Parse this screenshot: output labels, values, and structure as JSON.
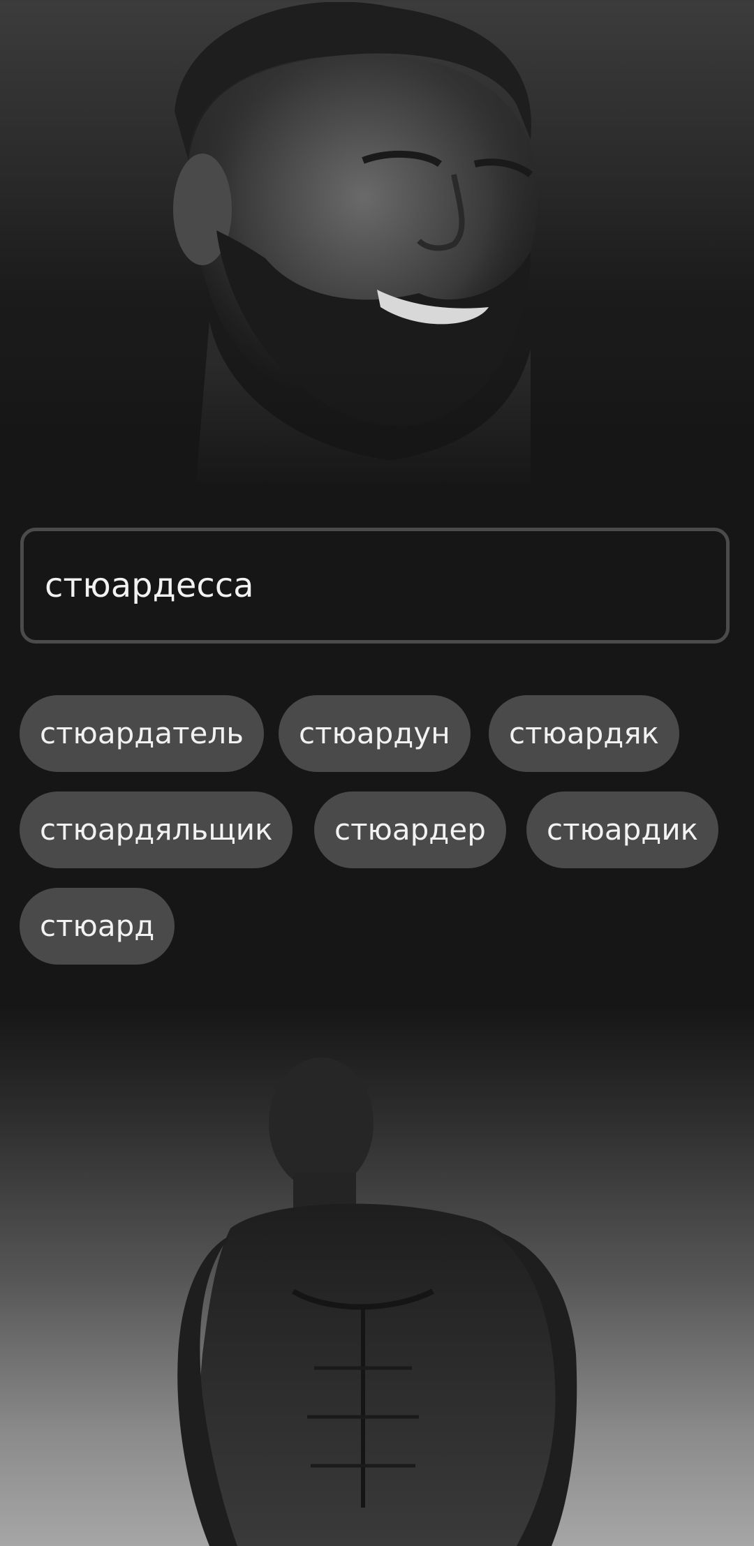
{
  "search": {
    "value": "стюардесса",
    "placeholder": ""
  },
  "suggestions": [
    "стюардатель",
    "стюардун",
    "стюардяк",
    "стюардяльщик",
    "стюардер",
    "стюардик",
    "стюард"
  ],
  "colors": {
    "background": "#161616",
    "chip": "#4a4a4a",
    "border": "#4b4b4b",
    "text": "#f2f2f2"
  }
}
